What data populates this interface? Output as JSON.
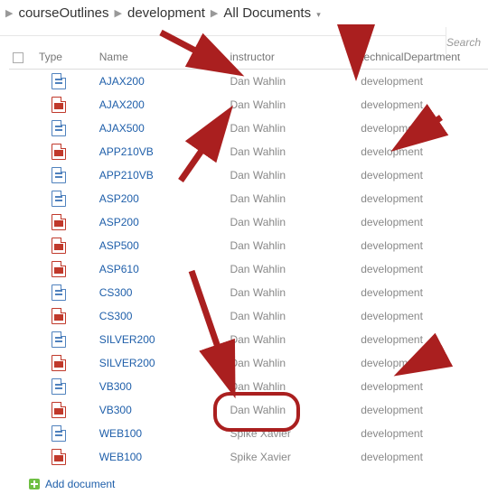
{
  "breadcrumb": {
    "items": [
      "courseOutlines",
      "development",
      "All Documents"
    ]
  },
  "search": {
    "placeholder": "Search"
  },
  "columns": {
    "type": "Type",
    "name": "Name",
    "instructor": "instructor",
    "dept": "technicalDepartment"
  },
  "rows": [
    {
      "icon": "doc",
      "name": "AJAX200",
      "instructor": "Dan Wahlin",
      "dept": "development"
    },
    {
      "icon": "pdf",
      "name": "AJAX200",
      "instructor": "Dan Wahlin",
      "dept": "development"
    },
    {
      "icon": "doc",
      "name": "AJAX500",
      "instructor": "Dan Wahlin",
      "dept": "development"
    },
    {
      "icon": "pdf",
      "name": "APP210VB",
      "instructor": "Dan Wahlin",
      "dept": "development"
    },
    {
      "icon": "doc",
      "name": "APP210VB",
      "instructor": "Dan Wahlin",
      "dept": "development"
    },
    {
      "icon": "doc",
      "name": "ASP200",
      "instructor": "Dan Wahlin",
      "dept": "development"
    },
    {
      "icon": "pdf",
      "name": "ASP200",
      "instructor": "Dan Wahlin",
      "dept": "development"
    },
    {
      "icon": "pdf",
      "name": "ASP500",
      "instructor": "Dan Wahlin",
      "dept": "development"
    },
    {
      "icon": "pdf",
      "name": "ASP610",
      "instructor": "Dan Wahlin",
      "dept": "development"
    },
    {
      "icon": "doc",
      "name": "CS300",
      "instructor": "Dan Wahlin",
      "dept": "development"
    },
    {
      "icon": "pdf",
      "name": "CS300",
      "instructor": "Dan Wahlin",
      "dept": "development"
    },
    {
      "icon": "doc",
      "name": "SILVER200",
      "instructor": "Dan Wahlin",
      "dept": "development"
    },
    {
      "icon": "pdf",
      "name": "SILVER200",
      "instructor": "Dan Wahlin",
      "dept": "development"
    },
    {
      "icon": "doc",
      "name": "VB300",
      "instructor": "Dan Wahlin",
      "dept": "development"
    },
    {
      "icon": "pdf",
      "name": "VB300",
      "instructor": "Dan Wahlin",
      "dept": "development"
    },
    {
      "icon": "doc",
      "name": "WEB100",
      "instructor": "Spike Xavier",
      "dept": "development"
    },
    {
      "icon": "pdf",
      "name": "WEB100",
      "instructor": "Spike Xavier",
      "dept": "development"
    }
  ],
  "actions": {
    "add": "Add document"
  },
  "colors": {
    "link": "#1f5faa",
    "arrow": "#aa1f1f"
  }
}
